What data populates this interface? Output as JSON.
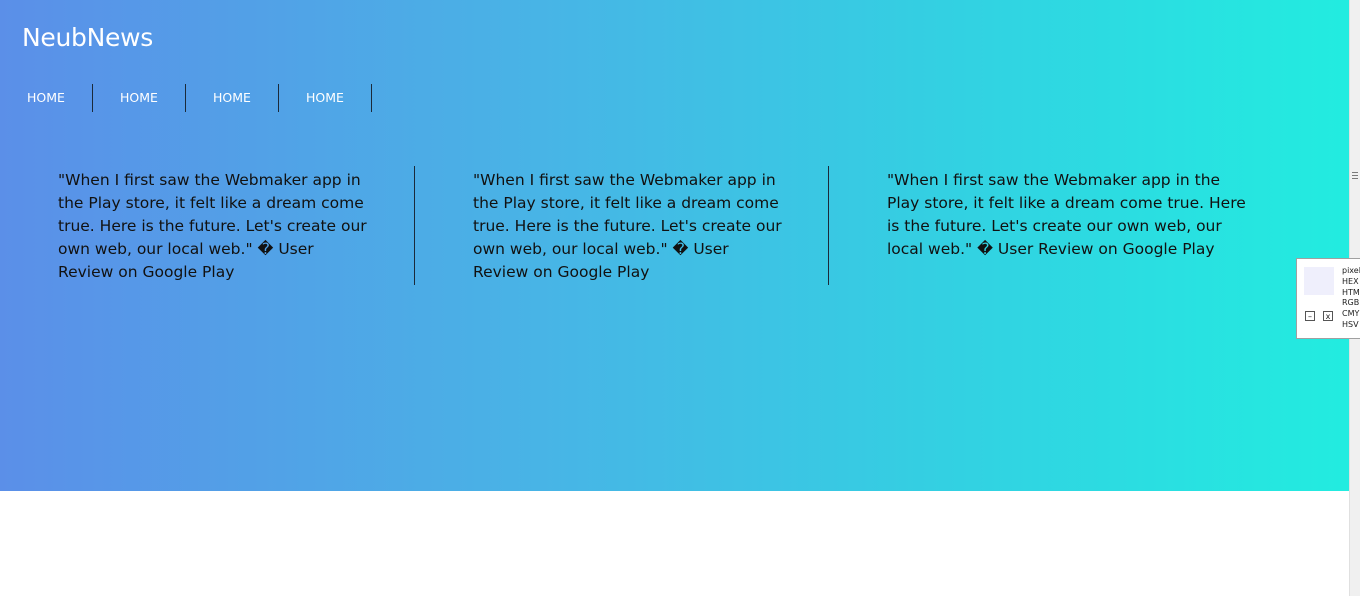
{
  "brand": "NeubNews",
  "nav": [
    "HOME",
    "HOME",
    "HOME",
    "HOME"
  ],
  "quotes": [
    "\"When I first saw the Webmaker app in the Play store, it felt like a dream come true. Here is the future. Let's create our own web, our local web.\" � User Review on Google Play",
    "\"When I first saw the Webmaker app in the Play store, it felt like a dream come true. Here is the future. Let's create our own web, our local web.\" � User Review on Google Play",
    "\"When I first saw the Webmaker app in the Play store, it felt like a dream come true. Here is the future. Let's create our own web, our local web.\" � User Review on Google Play"
  ],
  "colors": {
    "gradient_start": "#5b8fe8",
    "gradient_end": "#22ece0",
    "picker_swatch": "#efeffc"
  },
  "color_picker": {
    "labels": [
      "pixel",
      "HEX",
      "HTM",
      "RGB",
      "CMY",
      "HSV"
    ],
    "minimize_label": "–",
    "close_label": "x"
  }
}
